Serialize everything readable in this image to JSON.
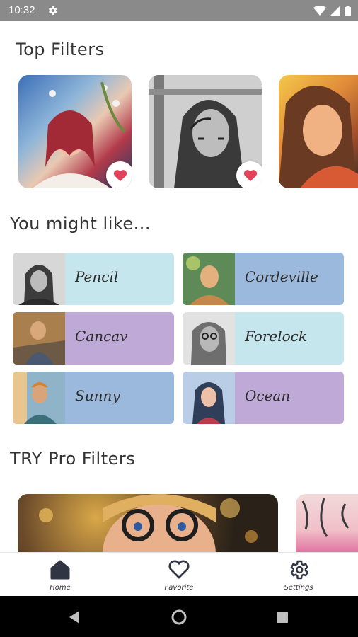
{
  "status_bar": {
    "time": "10:32"
  },
  "sections": {
    "top_filters": "Top Filters",
    "you_might_like": "You might like...",
    "pro_filters": "TRY Pro Filters"
  },
  "top_cards": [
    {
      "icon": "heart-icon",
      "favorite": true
    },
    {
      "icon": "heart-icon",
      "favorite": true
    },
    {
      "icon": null,
      "favorite": false
    }
  ],
  "like_filters": [
    {
      "label": "Pencil",
      "color": "#c6e6ee"
    },
    {
      "label": "Cordeville",
      "color": "#9bb9dc"
    },
    {
      "label": "Cancav",
      "color": "#bfa9d6"
    },
    {
      "label": "Forelock",
      "color": "#c6e6ee"
    },
    {
      "label": "Sunny",
      "color": "#9bb9dc"
    },
    {
      "label": "Ocean",
      "color": "#bfa9d6"
    }
  ],
  "bottom_nav": {
    "home": "Home",
    "favorite": "Favorite",
    "settings": "Settings"
  },
  "colors": {
    "heart": "#e0425a",
    "status_bar": "#8a8a8a",
    "nav_icon": "#2f3542"
  }
}
